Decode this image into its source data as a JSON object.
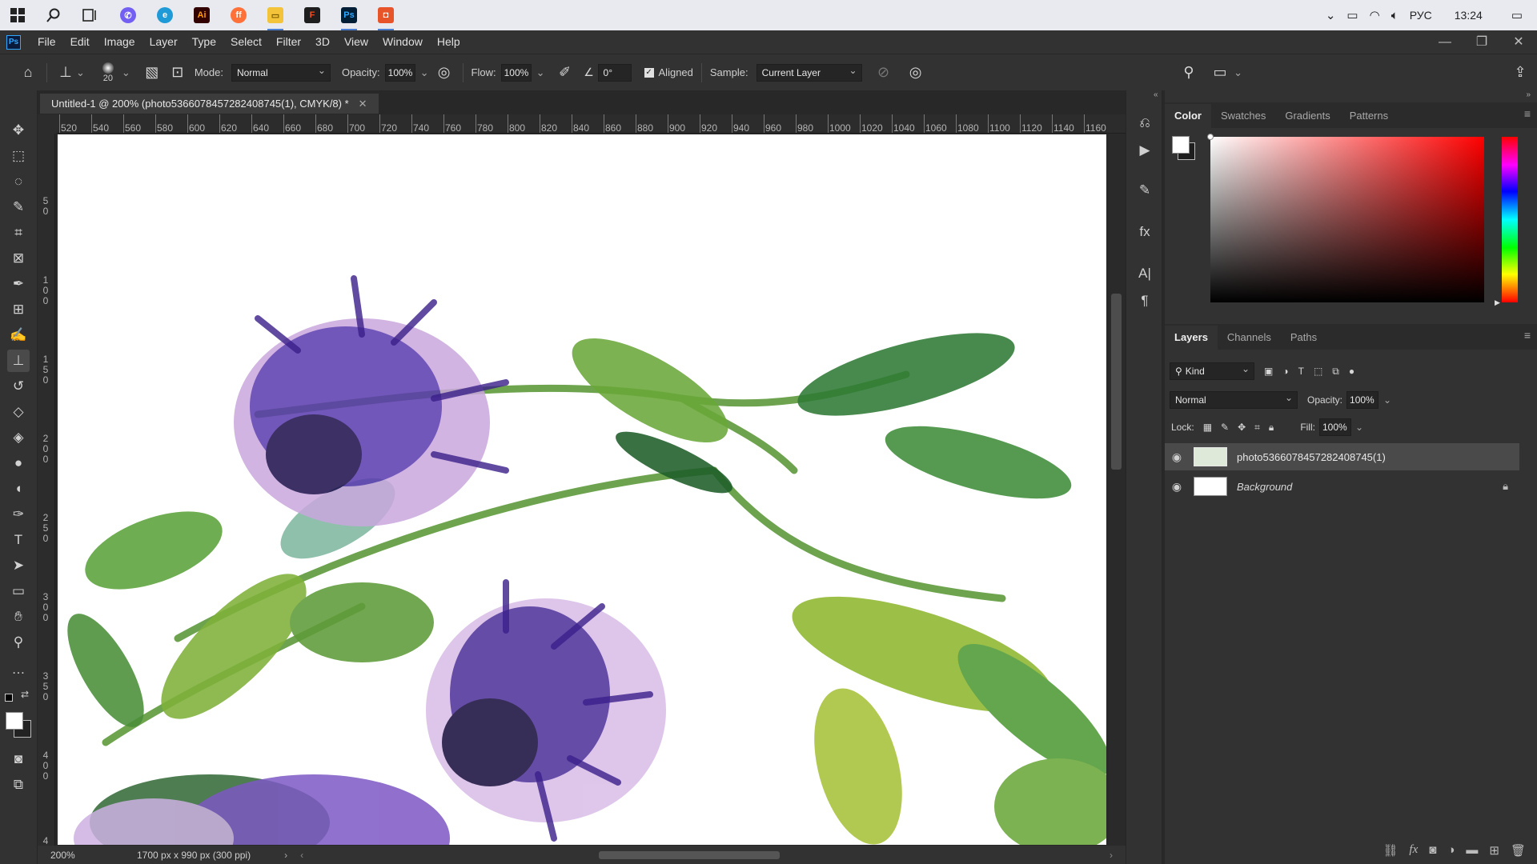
{
  "taskbar": {
    "time": "13:24",
    "lang": "РУС",
    "apps": [
      "windows-start",
      "search",
      "task-view",
      "viber",
      "edge",
      "illustrator",
      "firefox",
      "file-explorer",
      "figma",
      "photoshop",
      "office"
    ]
  },
  "menubar": {
    "items": [
      "File",
      "Edit",
      "Image",
      "Layer",
      "Type",
      "Select",
      "Filter",
      "3D",
      "View",
      "Window",
      "Help"
    ]
  },
  "options": {
    "brush_size": "20",
    "mode_label": "Mode:",
    "mode_value": "Normal",
    "opacity_label": "Opacity:",
    "opacity_value": "100%",
    "flow_label": "Flow:",
    "flow_value": "100%",
    "angle_value": "0°",
    "aligned_label": "Aligned",
    "sample_label": "Sample:",
    "sample_value": "Current Layer"
  },
  "document": {
    "tab_title": "Untitled-1 @ 200% (photo5366078457282408745(1), CMYK/8) *",
    "zoom": "200%",
    "doc_info": "1700 px x 990 px (300 ppi)",
    "hruler": [
      "520",
      "540",
      "560",
      "580",
      "600",
      "620",
      "640",
      "660",
      "680",
      "700",
      "720",
      "740",
      "760",
      "780",
      "800",
      "820",
      "840",
      "860",
      "880",
      "900",
      "920",
      "940",
      "960",
      "980",
      "1000",
      "1020",
      "1040",
      "1060",
      "1080",
      "1100",
      "1120",
      "1140",
      "1160"
    ],
    "vruler": [
      "50",
      "100",
      "150",
      "200",
      "250",
      "300",
      "350",
      "400",
      "4"
    ]
  },
  "color_panel": {
    "tabs": [
      "Color",
      "Swatches",
      "Gradients",
      "Patterns"
    ],
    "active": "Color"
  },
  "layers_panel": {
    "tabs": [
      "Layers",
      "Channels",
      "Paths"
    ],
    "filter_kind": "Kind",
    "blend_mode": "Normal",
    "opacity_label": "Opacity:",
    "opacity_value": "100%",
    "lock_label": "Lock:",
    "fill_label": "Fill:",
    "fill_value": "100%",
    "layers": [
      {
        "name": "photo5366078457282408745(1)",
        "selected": true
      },
      {
        "name": "Background",
        "locked": true
      }
    ]
  }
}
